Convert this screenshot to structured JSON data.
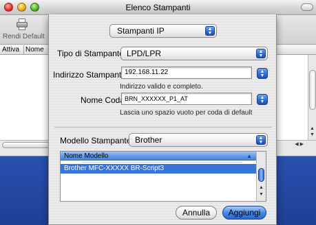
{
  "window": {
    "title": "Elenco Stampanti",
    "toolbar": {
      "default_button_label": "Rendi Default"
    },
    "list_columns": [
      "Attiva",
      "Nome"
    ]
  },
  "sheet": {
    "protocol_popup": "Stampanti IP",
    "printer_type_label": "Tipo di Stampante:",
    "printer_type_value": "LPD/LPR",
    "address_label": "Indirizzo Stampante:",
    "address_value": "192.168.11.22",
    "address_hint": "Indirizzo valido e completo.",
    "queue_label": "Nome Coda:",
    "queue_value": "BRN_XXXXXX_P1_AT",
    "queue_hint": "Lascia uno spazio vuoto per coda di default",
    "model_label": "Modello Stampante:",
    "model_value": "Brother",
    "model_table": {
      "header": "Nome Modello",
      "selected_row": "Brother MFC-XXXXX BR-Script3"
    },
    "cancel_button": "Annulla",
    "add_button": "Aggiungi"
  },
  "colors": {
    "accent_blue": "#3875d7",
    "desktop_blue": "#2d56b6"
  },
  "icons": [
    "printer-icon",
    "popup-arrows-icon",
    "scroll-up-icon",
    "scroll-down-icon",
    "sort-ascending-icon"
  ]
}
